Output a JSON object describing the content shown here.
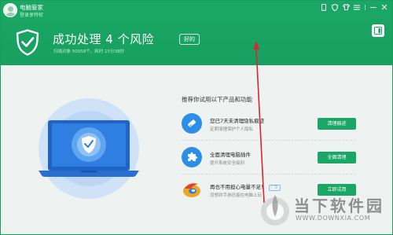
{
  "window": {
    "app_title": "电脑管家",
    "login_link": "登录享特权"
  },
  "header": {
    "result_title": "成功处理 4 个风险",
    "result_badge": "好的",
    "scan_info": "扫描对象 50958个，耗时 15分38秒"
  },
  "recommend": {
    "title": "推荐你试用以下产品和功能",
    "items": [
      {
        "name": "您已7天未清理隐私痕迹",
        "desc": "定期清理保护个人隐私",
        "button": "清理痕迹",
        "icon": "eraser-icon",
        "icon_color": "#2d8ee8"
      },
      {
        "name": "全面清理电脑插件",
        "desc": "提升系统安全级别",
        "button": "全面清理",
        "icon": "puzzle-icon",
        "icon_color": "#2d8ee8"
      },
      {
        "name": "再也不用担心电量不足！",
        "ad": "广告",
        "desc": "没想到手游还能在电脑上玩",
        "button": "立即试用",
        "icon": "game-logo-icon",
        "icon_color": "#f0a020"
      }
    ]
  },
  "watermark": {
    "cn": "当下软件园",
    "en": "WWW.DOWNXIA.COM"
  },
  "colors": {
    "brand_green": "#1aa765",
    "body_bg": "#eef3f1",
    "annotation_red": "#d9262c"
  }
}
